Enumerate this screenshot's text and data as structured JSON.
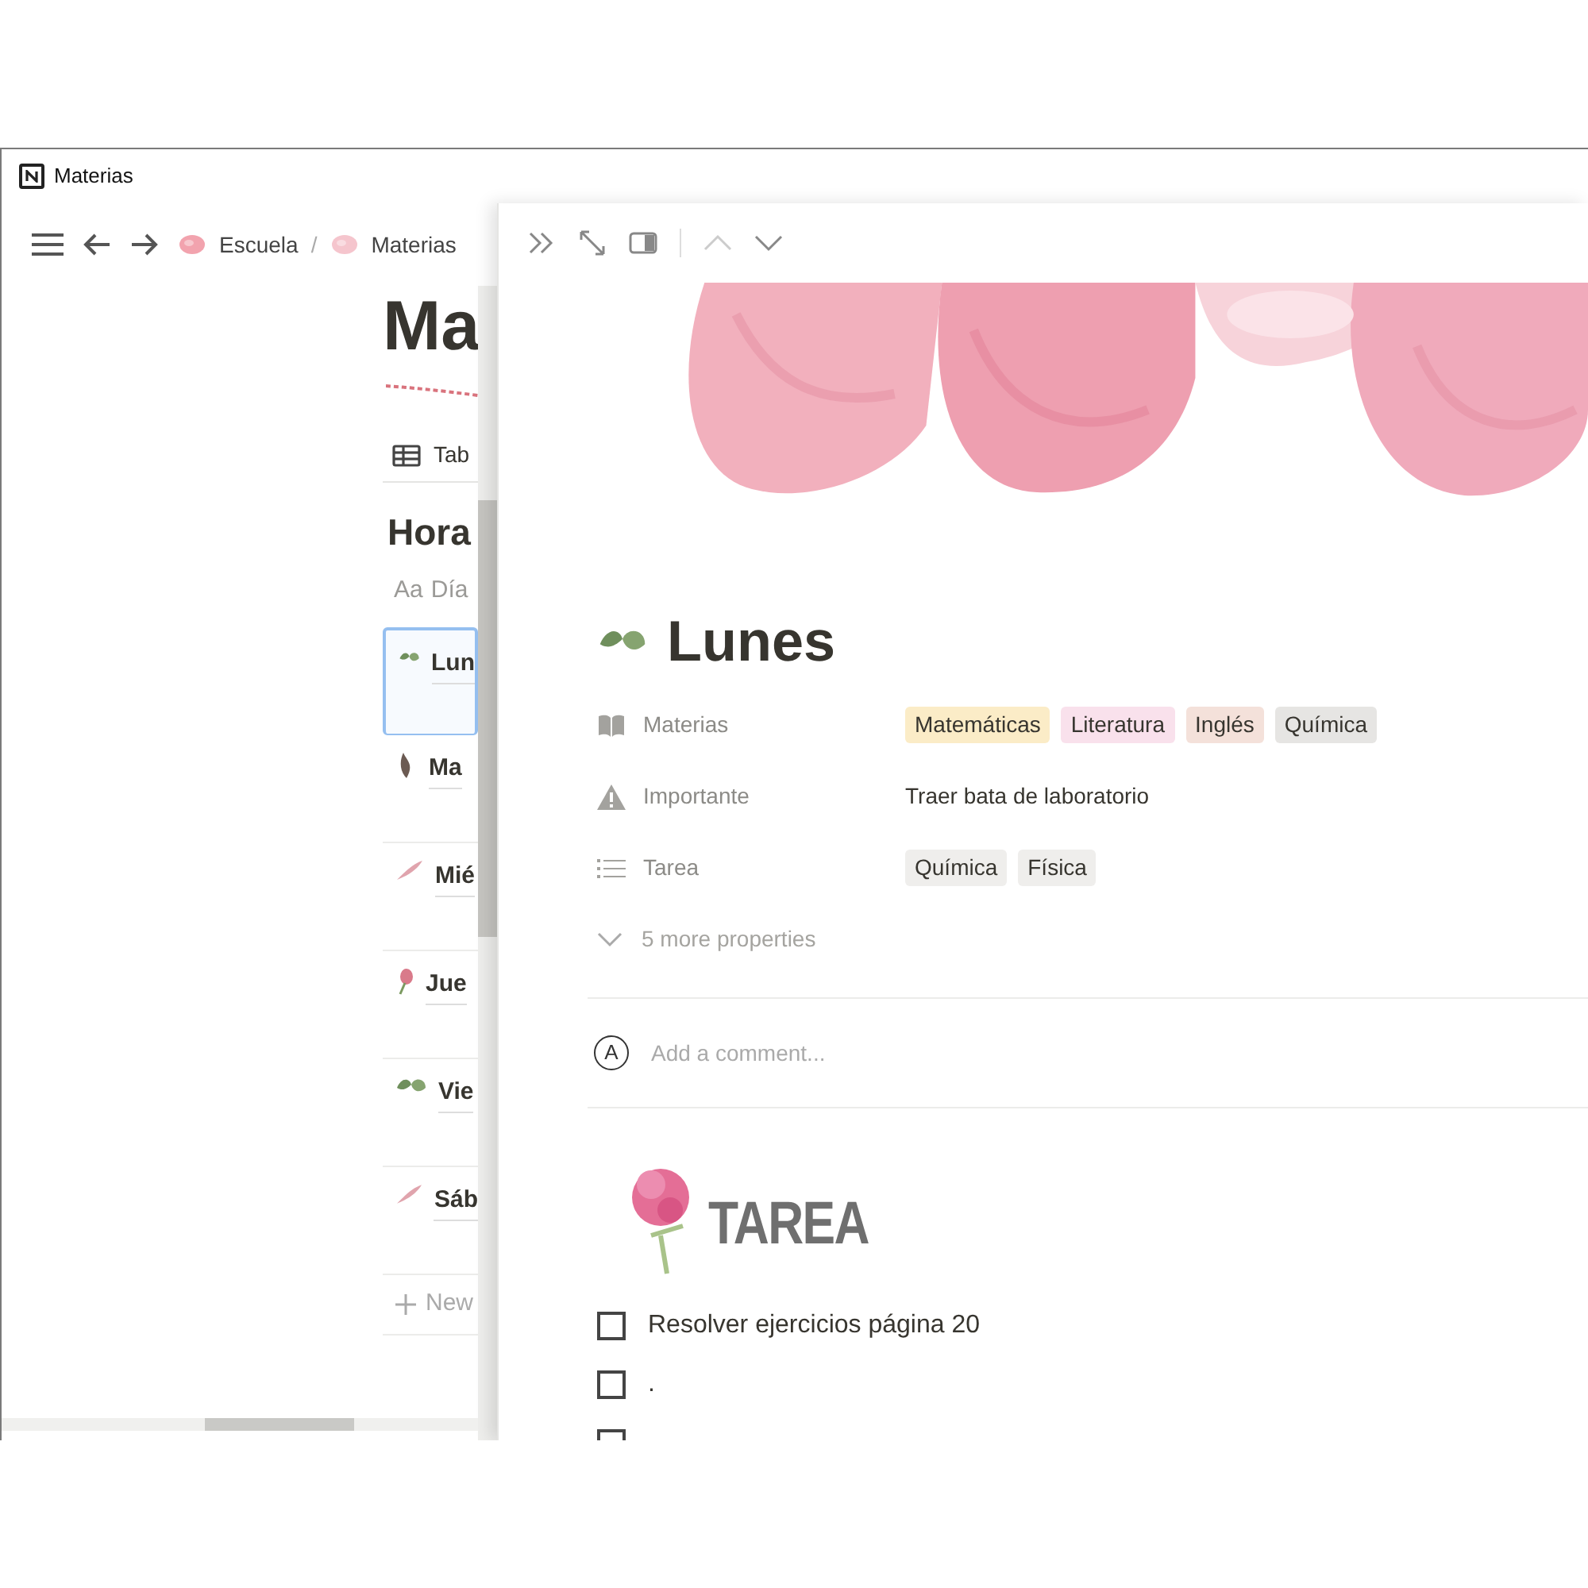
{
  "window": {
    "title": "Materias"
  },
  "breadcrumbs": [
    {
      "label": "Escuela"
    },
    {
      "label": "Materias"
    }
  ],
  "breadcrumb_separator": "/",
  "background_page": {
    "title": "Ma",
    "view_tab": "Tab",
    "section_heading": "Hora",
    "column_icon": "Aa",
    "column": "Día",
    "rows": [
      {
        "label": "Lun",
        "selected": true
      },
      {
        "label": "Ma",
        "selected": false
      },
      {
        "label": "Mié",
        "selected": false
      },
      {
        "label": "Jue",
        "selected": false
      },
      {
        "label": "Vie",
        "selected": false
      },
      {
        "label": "Sáb",
        "selected": false
      }
    ],
    "new_row": "New"
  },
  "peek": {
    "title": "Lunes",
    "properties": [
      {
        "kind": "tags",
        "label": "Materias",
        "tags": [
          {
            "text": "Matemáticas",
            "color": "#fbecc7"
          },
          {
            "text": "Literatura",
            "color": "#f9e1ec"
          },
          {
            "text": "Inglés",
            "color": "#f4e1da"
          },
          {
            "text": "Química",
            "color": "#e6e5e3"
          }
        ]
      },
      {
        "kind": "text",
        "label": "Importante",
        "value": "Traer bata de laboratorio"
      },
      {
        "kind": "list",
        "label": "Tarea",
        "tags": [
          {
            "text": "Química",
            "color": "#efeeec"
          },
          {
            "text": "Física",
            "color": "#efeeec"
          }
        ]
      }
    ],
    "more_properties": "5 more properties",
    "comment": {
      "avatar": "A",
      "placeholder": "Add a comment..."
    },
    "heading": "TAREA",
    "todos": [
      {
        "text": "Resolver ejercicios página 20",
        "checked": false
      },
      {
        "text": ".",
        "checked": false
      },
      {
        "checked": false
      }
    ]
  }
}
